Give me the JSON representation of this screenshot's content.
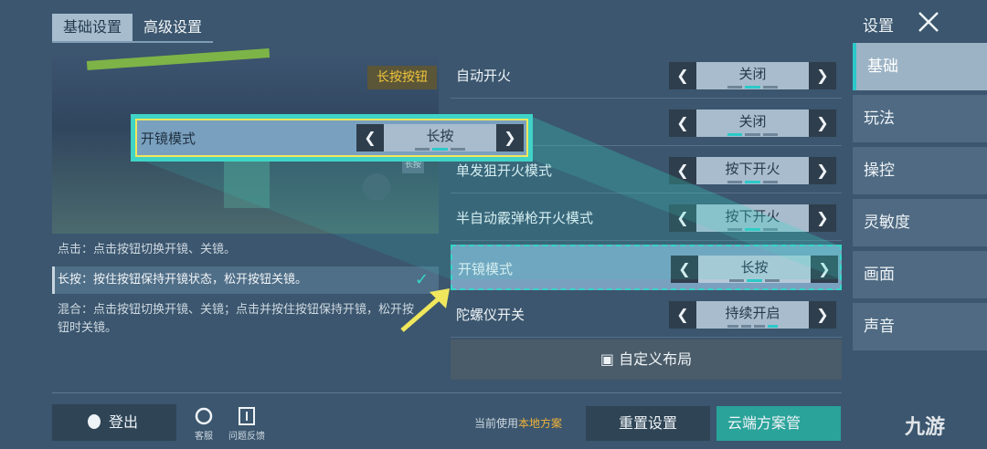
{
  "tabs": {
    "basic": "基础设置",
    "advanced": "高级设置"
  },
  "header": {
    "title": "设置"
  },
  "preview": {
    "long_press_badge": "长按按钮",
    "small_badge": "长按"
  },
  "descriptions": {
    "tap": "点击：点击按钮切换开镜、关镜。",
    "hold": "长按：按住按钮保持开镜状态，松开按钮关镜。",
    "mixed": "混合：点击按钮切换开镜、关镜；点击并按住按钮保持开镜，松开按钮时关镜。"
  },
  "settings": [
    {
      "label": "自动开火",
      "value": "关闭",
      "level": 2
    },
    {
      "label": "",
      "value": "关闭",
      "level": 1
    },
    {
      "label": "单发狙开火模式",
      "value": "按下开火",
      "level": 2
    },
    {
      "label": "半自动霰弹枪开火模式",
      "value": "按下开火",
      "level": 2
    },
    {
      "label": "开镜模式",
      "value": "长按",
      "level": 2
    },
    {
      "label": "陀螺仪开关",
      "value": "持续开启",
      "level": 4
    }
  ],
  "callout": {
    "label": "开镜模式",
    "value": "长按"
  },
  "custom_layout": "自定义布局",
  "sidebar": [
    {
      "label": "基础"
    },
    {
      "label": "玩法"
    },
    {
      "label": "操控"
    },
    {
      "label": "灵敏度"
    },
    {
      "label": "画面"
    },
    {
      "label": "声音"
    }
  ],
  "bottom": {
    "logout": "登出",
    "service": "客服",
    "feedback": "问题反馈",
    "current_plan_prefix": "当前使用",
    "current_plan_value": "本地方案",
    "reset": "重置设置",
    "cloud": "云端方案管"
  },
  "watermark": "九游",
  "colors": {
    "accent": "#2cc9c8",
    "highlight": "#f1e75d",
    "warning": "#f0b33a"
  }
}
